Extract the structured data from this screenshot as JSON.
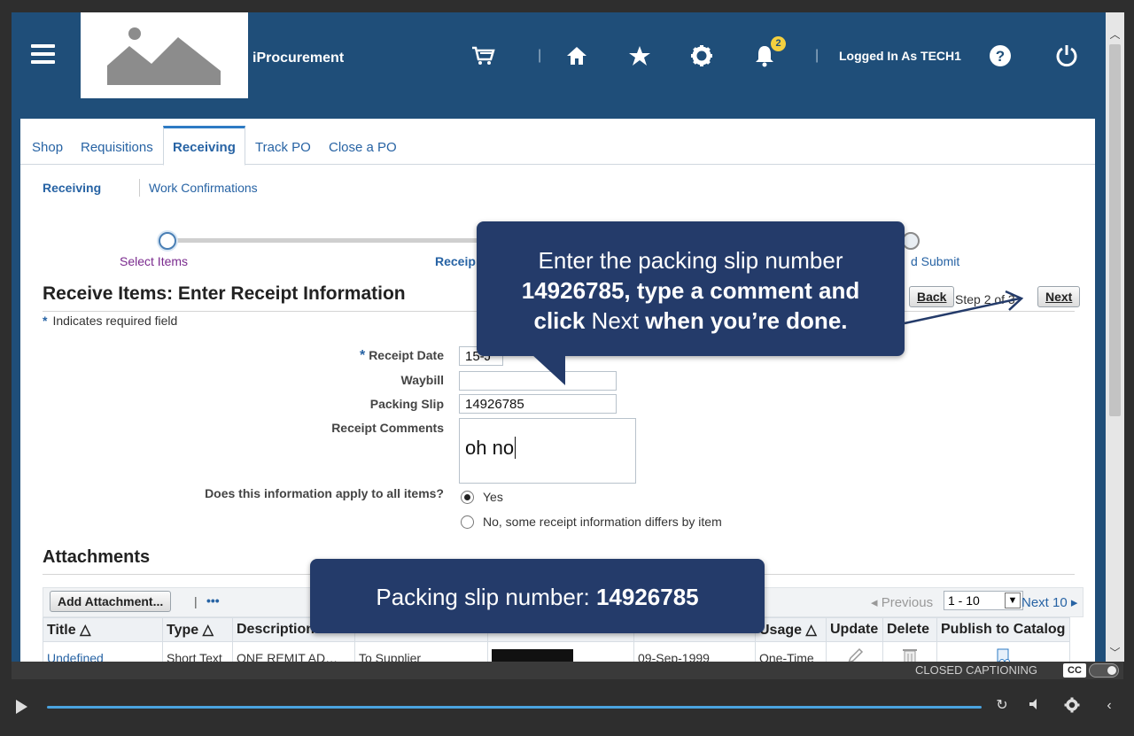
{
  "header": {
    "app_title": "iProcurement",
    "logged_in": "Logged In As TECH1",
    "notification_count": "2",
    "icons": [
      "menu-icon",
      "cart-icon",
      "home-icon",
      "star-icon",
      "gear-icon",
      "bell-icon",
      "help-icon",
      "power-icon"
    ]
  },
  "tabs": [
    "Shop",
    "Requisitions",
    "Receiving",
    "Track PO",
    "Close a PO"
  ],
  "active_tab": "Receiving",
  "subtabs": [
    "Receiving",
    "Work Confirmations"
  ],
  "train": {
    "step1": "Select Items",
    "step2": "Receip",
    "step3": "d Submit"
  },
  "page_title": "Receive Items: Enter Receipt Information",
  "required_note": "Indicates required field",
  "nav": {
    "back": "Back",
    "step_text": "Step 2 of 3",
    "next": "Next"
  },
  "form": {
    "receipt_date_label": "Receipt Date",
    "receipt_date_value": "15-J",
    "waybill_label": "Waybill",
    "waybill_value": "",
    "packing_slip_label": "Packing Slip",
    "packing_slip_value": "14926785",
    "comments_label": "Receipt Comments",
    "comments_value": "oh no",
    "apply_question": "Does this information apply to all items?",
    "option_yes": "Yes",
    "option_no": "No, some receipt information differs by item",
    "selected_option": "Yes"
  },
  "attachments": {
    "title": "Attachments",
    "add_button": "Add Attachment...",
    "more": "•••",
    "previous": "Previous",
    "range": "1 - 10",
    "next10": "Next 10",
    "columns": [
      "Title",
      "Type",
      "Description",
      "",
      "",
      "",
      "Usage",
      "Update",
      "Delete",
      "Publish to Catalog"
    ],
    "rows": [
      {
        "title": "Undefined",
        "type": "Short Text",
        "description": "ONE REMIT AD…",
        "category": "To Supplier",
        "date": "09-Sep-1999",
        "usage": "One-Time"
      }
    ]
  },
  "callouts": {
    "instruction_line1": "Enter the packing slip number",
    "instruction_num": "14926785",
    "instruction_line2": ", type a comment and",
    "instruction_click": "click",
    "instruction_next": "Next",
    "instruction_end": "when you’re done.",
    "packing_label": "Packing slip number: ",
    "packing_num": "14926785"
  },
  "player": {
    "cc_label": "CLOSED CAPTIONING",
    "cc_badge": "CC"
  },
  "colors": {
    "header_bg": "#1f4e79",
    "callout_bg": "#243b6a",
    "link": "#2763a4",
    "progress": "#4aa3df"
  }
}
